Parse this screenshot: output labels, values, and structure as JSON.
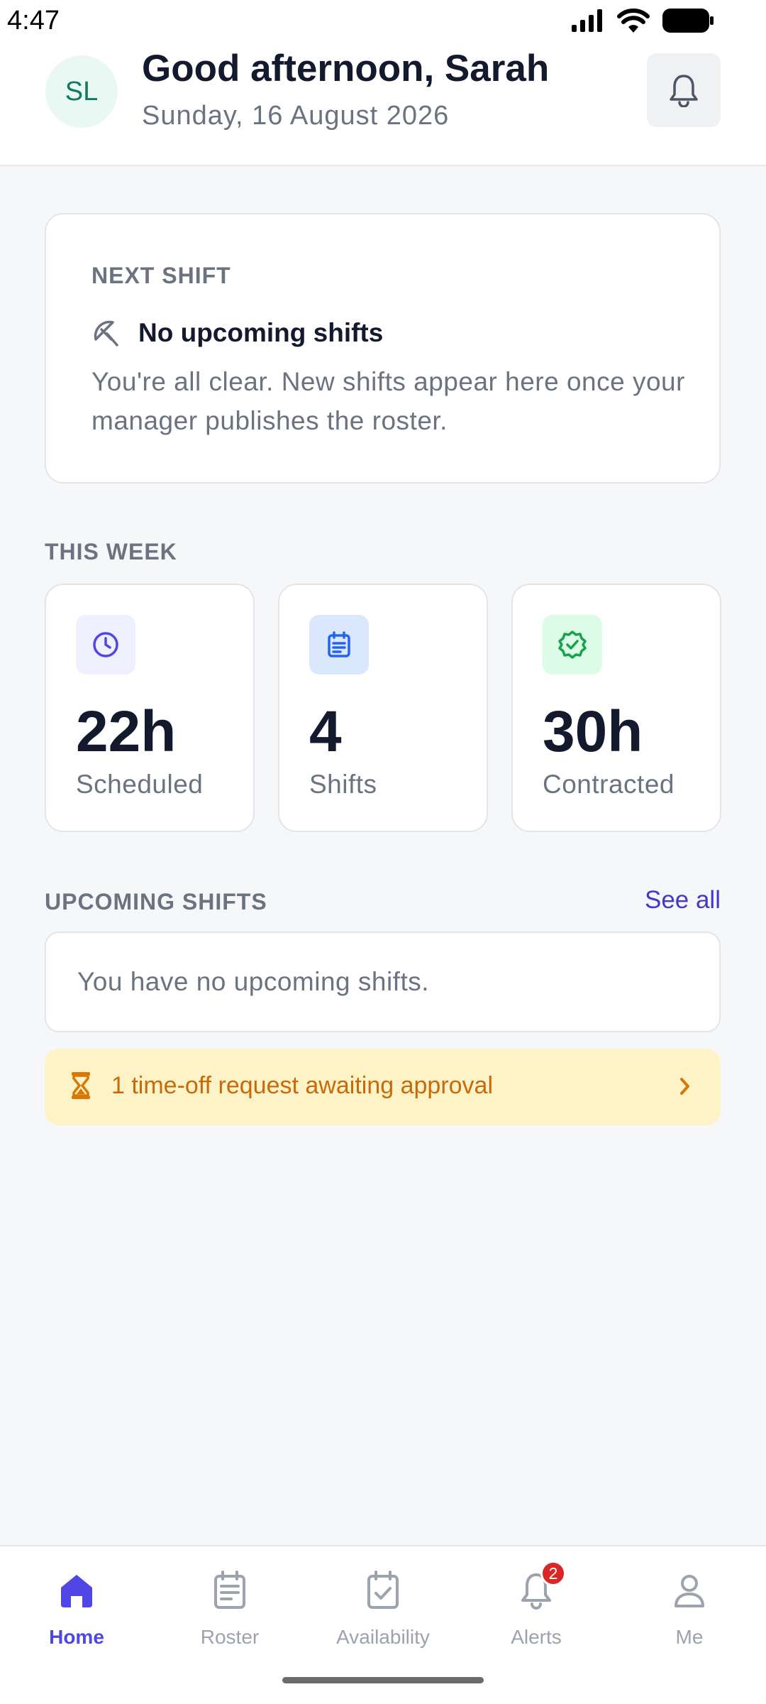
{
  "status_bar": {
    "time": "4:47"
  },
  "header": {
    "avatar_initials": "SL",
    "greeting": "Good afternoon, Sarah",
    "date": "Sunday, 16 August 2026"
  },
  "next_shift": {
    "label": "NEXT SHIFT",
    "title": "No upcoming shifts",
    "description": "You're all clear. New shifts appear here once your manager publishes the roster."
  },
  "this_week": {
    "label": "THIS WEEK",
    "stats": [
      {
        "value": "22h",
        "caption": "Scheduled",
        "icon": "clock-icon",
        "icon_color": "#4f46e5",
        "icon_bg": "#eef0fd"
      },
      {
        "value": "4",
        "caption": "Shifts",
        "icon": "calendar-list-icon",
        "icon_color": "#2563eb",
        "icon_bg": "#dbe7fd"
      },
      {
        "value": "30h",
        "caption": "Contracted",
        "icon": "verified-badge-icon",
        "icon_color": "#16a34a",
        "icon_bg": "#dcfce7"
      }
    ]
  },
  "upcoming": {
    "label": "UPCOMING SHIFTS",
    "see_all": "See all",
    "empty": "You have no upcoming shifts."
  },
  "time_off": {
    "text": "1 time-off request awaiting approval",
    "color": "#c76a0a",
    "background": "#fef3c7"
  },
  "nav": {
    "items": [
      {
        "label": "Home",
        "icon": "home-icon",
        "active": true
      },
      {
        "label": "Roster",
        "icon": "roster-icon",
        "active": false
      },
      {
        "label": "Availability",
        "icon": "availability-icon",
        "active": false
      },
      {
        "label": "Alerts",
        "icon": "bell-icon",
        "active": false,
        "badge": "2"
      },
      {
        "label": "Me",
        "icon": "person-icon",
        "active": false
      }
    ]
  },
  "colors": {
    "accent": "#4f46e5",
    "text": "#141a2e",
    "muted": "#6b7280",
    "badge": "#dc2626"
  }
}
